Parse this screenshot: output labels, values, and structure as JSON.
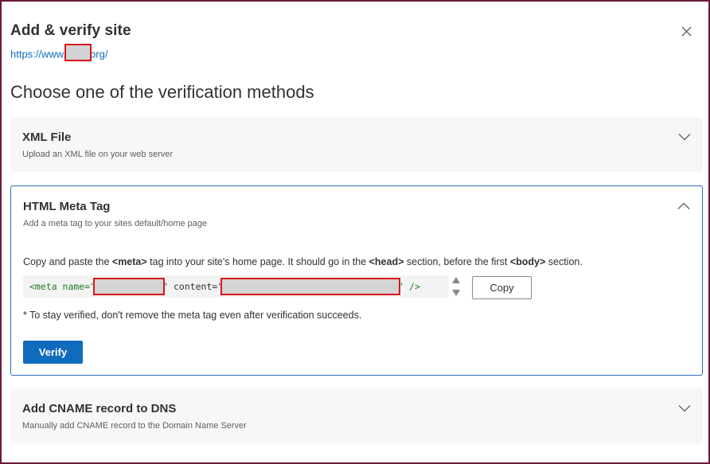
{
  "dialog": {
    "title": "Add & verify site",
    "url_prefix": "https://www.",
    "url_suffix": "org/",
    "close_icon": "close-icon"
  },
  "heading": "Choose one of the verification methods",
  "methods": [
    {
      "title": "XML File",
      "subtitle": "Upload an XML file on your web server",
      "expanded": false
    },
    {
      "title": "HTML Meta Tag",
      "subtitle": "Add a meta tag to your sites default/home page",
      "expanded": true,
      "instructions": {
        "part1": "Copy and paste the ",
        "tag_meta": "<meta>",
        "part2": " tag into your site's home page. It should go in the ",
        "tag_head": "<head>",
        "part3": " section, before the first ",
        "tag_body": "<body>",
        "part4": " section."
      },
      "code": {
        "open": "<meta name=\"",
        "mid": "\" content=\"",
        "close": "\" />"
      },
      "copy_label": "Copy",
      "note": "* To stay verified, don't remove the meta tag even after verification succeeds.",
      "verify_label": "Verify"
    },
    {
      "title": "Add CNAME record to DNS",
      "subtitle": "Manually add CNAME record to the Domain Name Server",
      "expanded": false
    }
  ],
  "colors": {
    "accent": "#0f6cbd",
    "border_frame": "#6b1a3a",
    "redaction": "#d8141a",
    "code_green": "#217a27"
  }
}
